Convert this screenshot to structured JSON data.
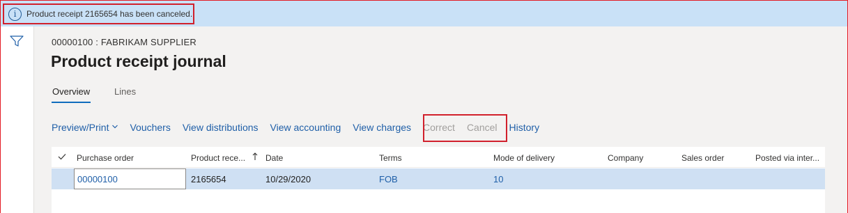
{
  "message_bar": {
    "text": "Product receipt 2165654 has been canceled.",
    "info_glyph": "i",
    "icon": "info-icon"
  },
  "rail": {
    "icon": "filter-icon"
  },
  "header": {
    "subtitle": "00000100 : FABRIKAM SUPPLIER",
    "title": "Product receipt journal"
  },
  "tabs": [
    {
      "label": "Overview",
      "active": true
    },
    {
      "label": "Lines",
      "active": false
    }
  ],
  "actions": [
    {
      "label": "Preview/Print",
      "enabled": true,
      "has_dropdown": true
    },
    {
      "label": "Vouchers",
      "enabled": true
    },
    {
      "label": "View distributions",
      "enabled": true
    },
    {
      "label": "View accounting",
      "enabled": true
    },
    {
      "label": "View charges",
      "enabled": true
    },
    {
      "label": "Correct",
      "enabled": false
    },
    {
      "label": "Cancel",
      "enabled": false
    },
    {
      "label": "History",
      "enabled": true
    }
  ],
  "grid": {
    "columns": [
      "Purchase order",
      "Product rece...",
      "Date",
      "Terms",
      "Mode of delivery",
      "Company",
      "Sales order",
      "Posted via inter..."
    ],
    "rows": [
      {
        "purchase_order": "00000100",
        "product_receipt": "2165654",
        "date": "10/29/2020",
        "terms": "FOB",
        "mode_of_delivery": "10",
        "company": "",
        "sales_order": "",
        "posted_via": ""
      }
    ]
  },
  "colors": {
    "message_bar": "#c9e1f7",
    "link": "#1f5fa8",
    "disabled": "#a19f9d",
    "selected_row": "#cfe0f3",
    "highlight_box": "#d1202c"
  }
}
